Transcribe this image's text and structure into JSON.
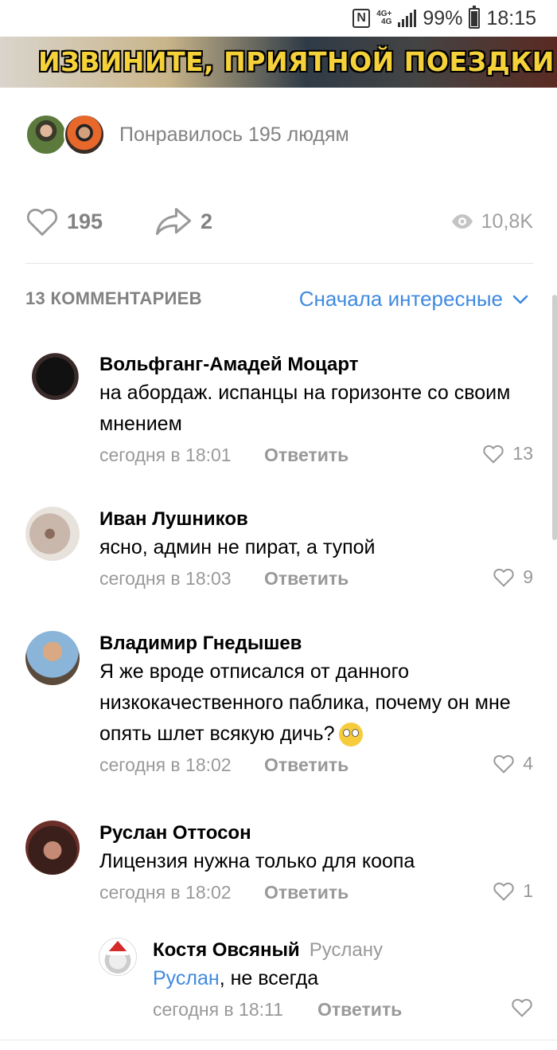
{
  "status_bar": {
    "network": "4G+",
    "network_small": "4G",
    "battery": "99%",
    "time": "18:15"
  },
  "banner": {
    "text": "ИЗВИНИТЕ, ПРИЯТНОЙ ПОЕЗДКИ"
  },
  "likes": {
    "text": "Понравилось 195 людям"
  },
  "actions": {
    "like_count": "195",
    "share_count": "2",
    "views": "10,8K"
  },
  "comments_header": {
    "count": "13 КОММЕНТАРИЕВ",
    "sort": "Сначала интересные"
  },
  "comments": [
    {
      "author": "Вольфганг-Амадей Моцарт",
      "text": "на абордаж. испанцы на горизонте со своим мнением",
      "time": "сегодня в 18:01",
      "reply": "Ответить",
      "likes": "13"
    },
    {
      "author": "Иван Лушников",
      "text": "ясно, админ не пират, а тупой",
      "time": "сегодня в 18:03",
      "reply": "Ответить",
      "likes": "9"
    },
    {
      "author": "Владимир Гнедышев",
      "text": "Я же вроде отписался от данного низкокачественного паблика, почему он мне опять шлет всякую дичь?",
      "time": "сегодня в 18:02",
      "reply": "Ответить",
      "likes": "4"
    },
    {
      "author": "Руслан Оттосон",
      "text": "Лицензия нужна только для коопа",
      "time": "сегодня в 18:02",
      "reply": "Ответить",
      "likes": "1"
    }
  ],
  "reply": {
    "author": "Костя Овсяный",
    "reply_to": "Руслану",
    "mention": "Руслан",
    "text": ", не всегда",
    "time": "сегодня в 18:11",
    "reply": "Ответить"
  },
  "colors": {
    "accent": "#3f8ae0",
    "secondary_text": "#828282",
    "meta_text": "#999999"
  }
}
